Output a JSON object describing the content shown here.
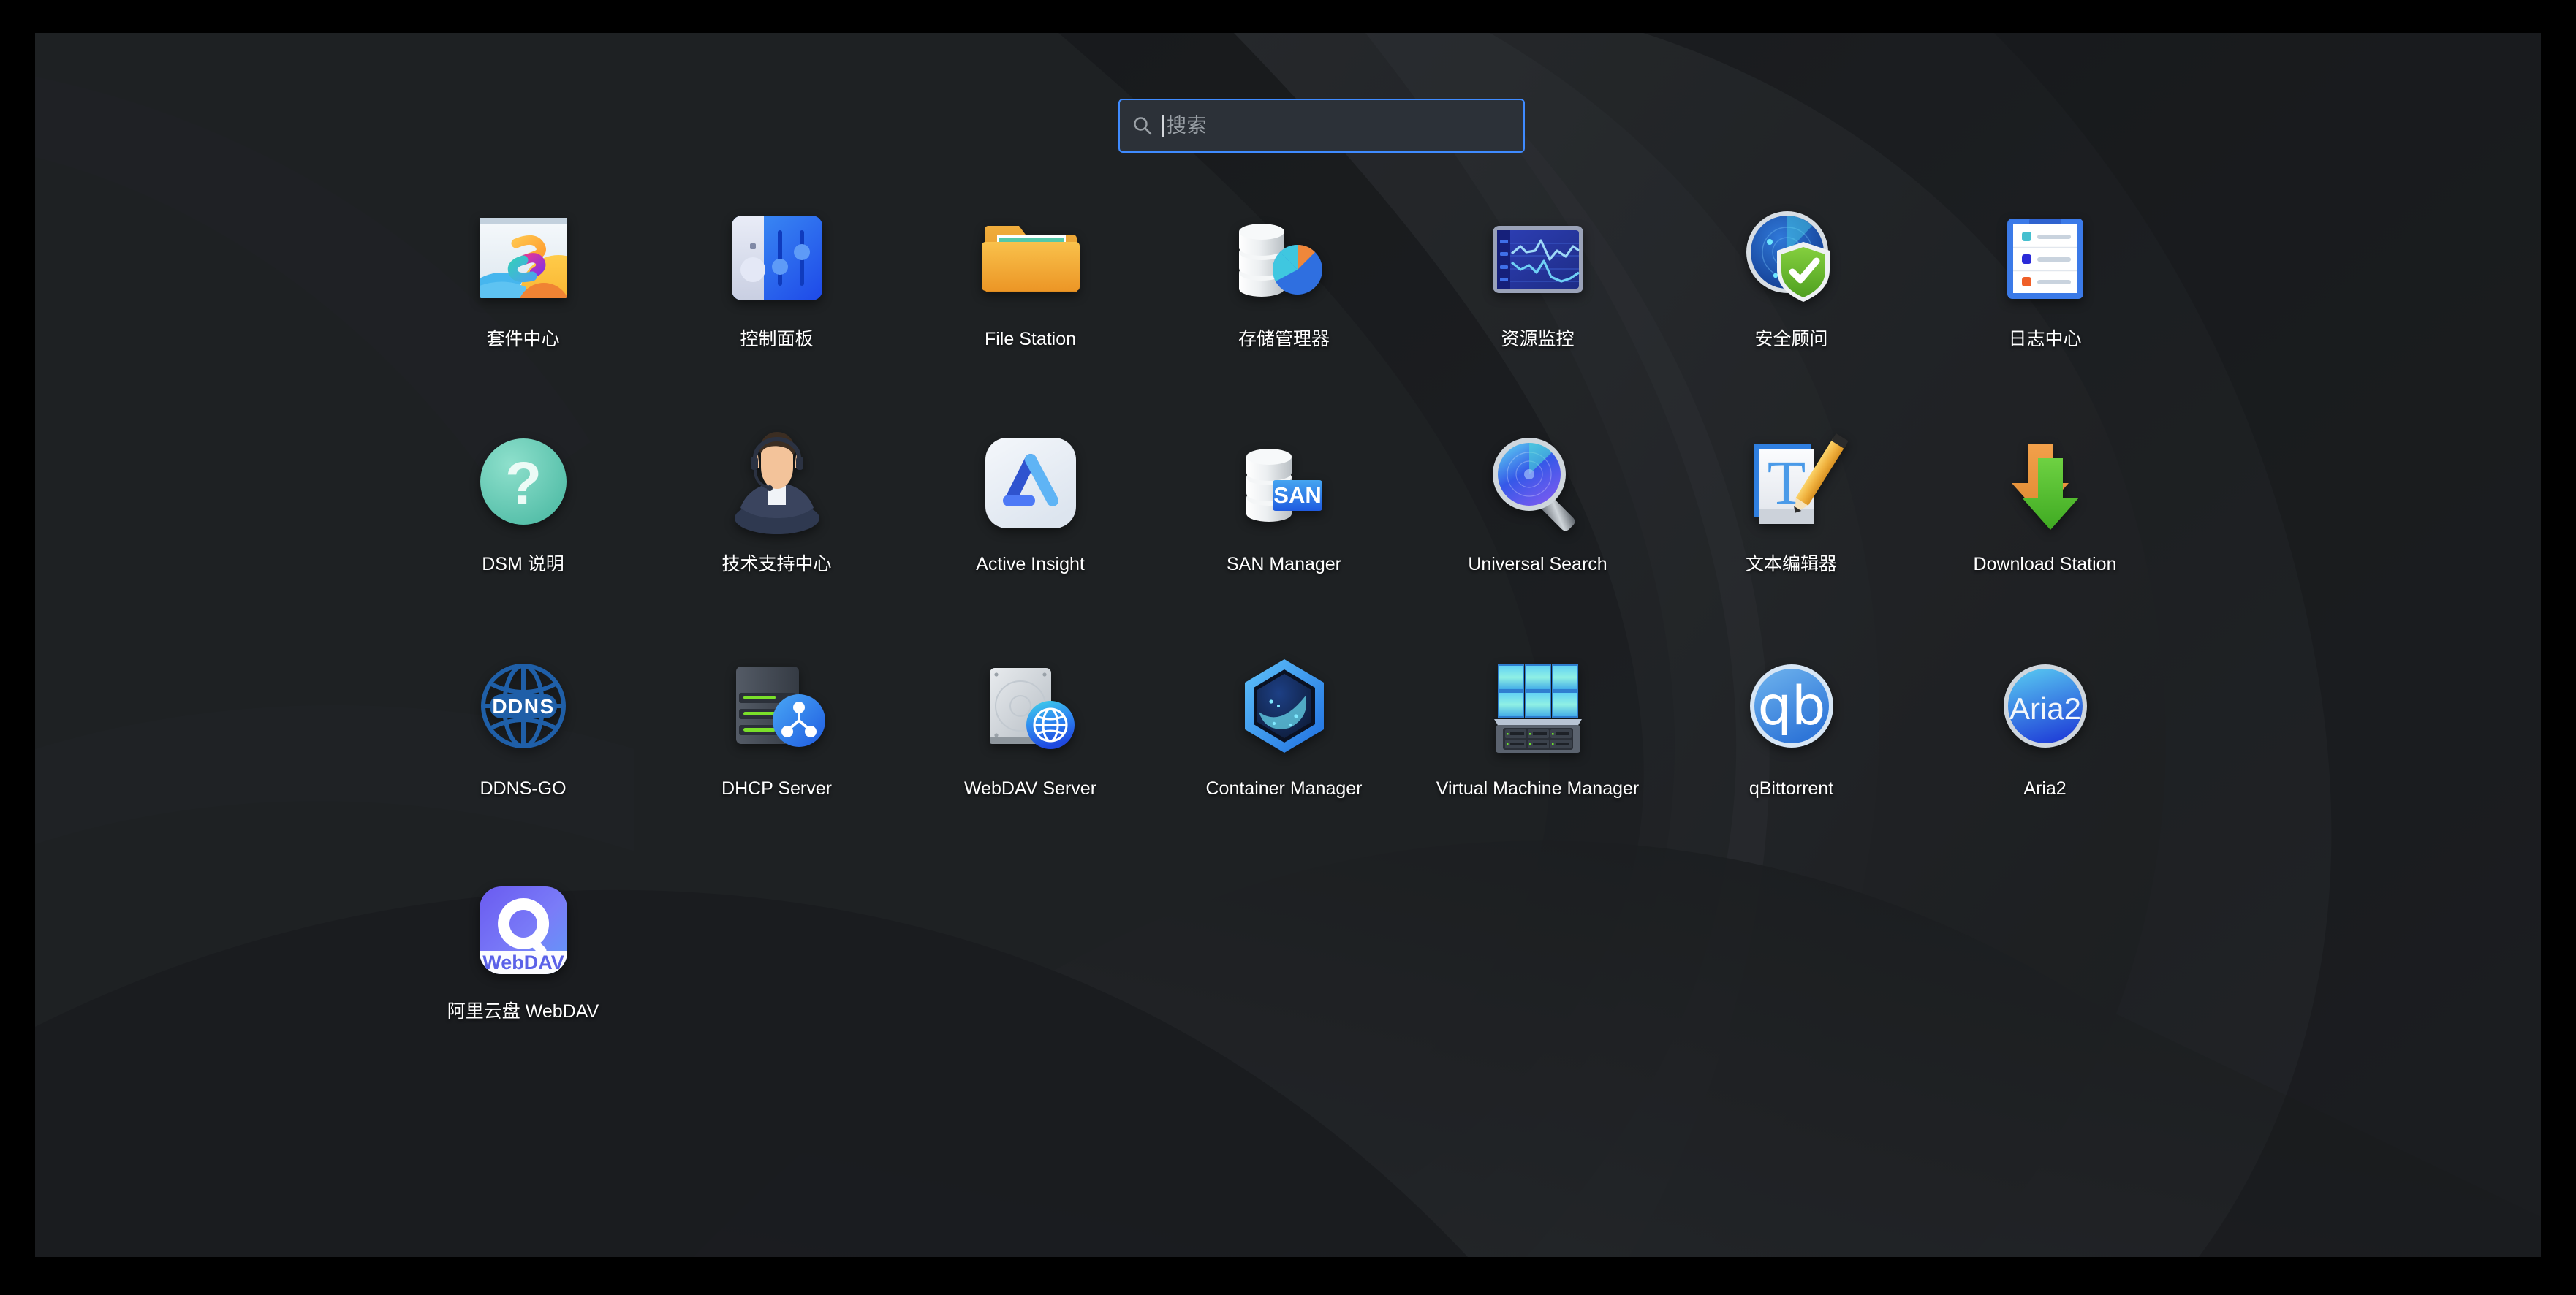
{
  "desktop": {
    "app_title": "Synology DSM Application Launcher",
    "background_style": "dark abstract wave wallpaper"
  },
  "search": {
    "placeholder": "搜索",
    "value": "",
    "icon": "search-icon",
    "focused": true,
    "border_color": "#3f8bff",
    "background_color": "#2c3138"
  },
  "grid": {
    "columns": 7,
    "rows": [
      [
        {
          "id": "package-center",
          "label": "套件中心",
          "icon": "package-center-icon"
        },
        {
          "id": "control-panel",
          "label": "控制面板",
          "icon": "control-panel-icon"
        },
        {
          "id": "file-station",
          "label": "File Station",
          "icon": "file-station-icon"
        },
        {
          "id": "storage-manager",
          "label": "存储管理器",
          "icon": "storage-manager-icon"
        },
        {
          "id": "resource-monitor",
          "label": "资源监控",
          "icon": "resource-monitor-icon"
        },
        {
          "id": "security-advisor",
          "label": "安全顾问",
          "icon": "security-advisor-icon"
        },
        {
          "id": "log-center",
          "label": "日志中心",
          "icon": "log-center-icon"
        }
      ],
      [
        {
          "id": "dsm-help",
          "label": "DSM 说明",
          "icon": "dsm-help-icon"
        },
        {
          "id": "support-center",
          "label": "技术支持中心",
          "icon": "support-center-icon"
        },
        {
          "id": "active-insight",
          "label": "Active Insight",
          "icon": "active-insight-icon"
        },
        {
          "id": "san-manager",
          "label": "SAN Manager",
          "icon": "san-manager-icon"
        },
        {
          "id": "universal-search",
          "label": "Universal Search",
          "icon": "universal-search-icon"
        },
        {
          "id": "text-editor",
          "label": "文本编辑器",
          "icon": "text-editor-icon"
        },
        {
          "id": "download-station",
          "label": "Download Station",
          "icon": "download-station-icon"
        }
      ],
      [
        {
          "id": "ddns-go",
          "label": "DDNS-GO",
          "icon": "ddns-go-icon"
        },
        {
          "id": "dhcp-server",
          "label": "DHCP Server",
          "icon": "dhcp-server-icon"
        },
        {
          "id": "webdav-server",
          "label": "WebDAV Server",
          "icon": "webdav-server-icon"
        },
        {
          "id": "container-manager",
          "label": "Container Manager",
          "icon": "container-manager-icon"
        },
        {
          "id": "virtual-machine-manager",
          "label": "Virtual Machine Manager",
          "icon": "virtual-machine-manager-icon"
        },
        {
          "id": "qbittorrent",
          "label": "qBittorrent",
          "icon": "qbittorrent-icon"
        },
        {
          "id": "aria2",
          "label": "Aria2",
          "icon": "aria2-icon"
        }
      ],
      [
        {
          "id": "aliyun-webdav",
          "label": "阿里云盘 WebDAV",
          "icon": "aliyun-webdav-icon"
        }
      ]
    ]
  },
  "icon_text": {
    "ddns": "DDNS",
    "san": "SAN",
    "qb": "qb",
    "aria2": "Aria2",
    "webdav": "WebDAV",
    "text_editor_letter": "T",
    "help_mark": "?"
  },
  "colors": {
    "accent": "#3f8bff",
    "label_text": "#ffffff",
    "placeholder_text": "#9aa0a6",
    "desktop_background": "#1d2024",
    "letterbox": "#000000"
  }
}
